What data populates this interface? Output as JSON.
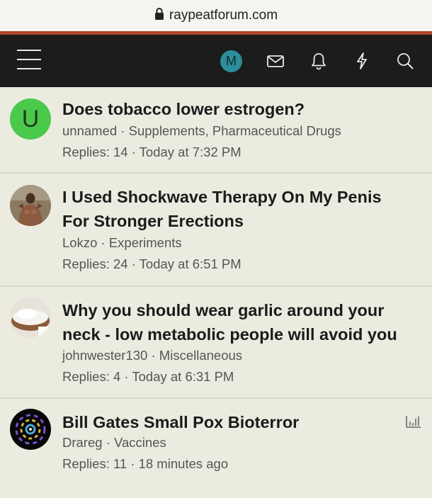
{
  "browser": {
    "url": "raypeatforum.com"
  },
  "colors": {
    "accent": "#b2462b",
    "navbar": "#1c1c1c",
    "background": "#ecebe0",
    "avatar_member": "#2b8e99",
    "avatar_unnamed": "#4bc94b"
  },
  "navbar": {
    "avatar_letter": "M",
    "icons": [
      "menu-icon",
      "mail-icon",
      "bell-icon",
      "lightning-icon",
      "search-icon"
    ]
  },
  "threads": [
    {
      "avatar_letter": "U",
      "title_lines": [
        "Does tobacco lower estrogen?"
      ],
      "author": "unnamed",
      "forum": "Supplements, Pharmaceutical Drugs",
      "stats": "Replies: 14 · Today at 7:32 PM"
    },
    {
      "title_lines": [
        "I Used Shockwave Therapy On My Penis",
        "For Stronger Erections"
      ],
      "author": "Lokzo",
      "forum": "Experiments",
      "stats": "Replies: 24 · Today at 6:51 PM"
    },
    {
      "title_lines": [
        "Why you should wear garlic around your",
        "neck - low metabolic people will avoid you"
      ],
      "author": "johnwester130",
      "forum": "Miscellaneous",
      "stats": "Replies: 4 · Today at 6:31 PM"
    },
    {
      "title_lines": [
        "Bill Gates Small Pox Bioterror"
      ],
      "author": "Drareg",
      "forum": "Vaccines",
      "stats": "Replies: 11 · 18 minutes ago"
    }
  ],
  "meta_separator": " · "
}
